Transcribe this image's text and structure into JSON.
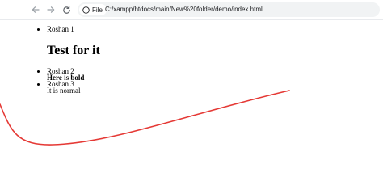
{
  "browser": {
    "back_icon": "arrow-left-icon",
    "forward_icon": "arrow-right-icon",
    "reload_icon": "reload-icon",
    "site_info_icon": "info-circle-icon",
    "site_chip_label": "File",
    "url": "C:/xampp/htdocs/main/New%20folder/demo/index.html"
  },
  "page": {
    "list1": [
      "Roshan 1"
    ],
    "heading": "Test for it",
    "list2": [
      {
        "label": "Roshan 2",
        "extra": "Here is bold"
      },
      {
        "label": "Roshan 3",
        "extra": "It is normal"
      }
    ],
    "curve_color": "#e53935"
  }
}
